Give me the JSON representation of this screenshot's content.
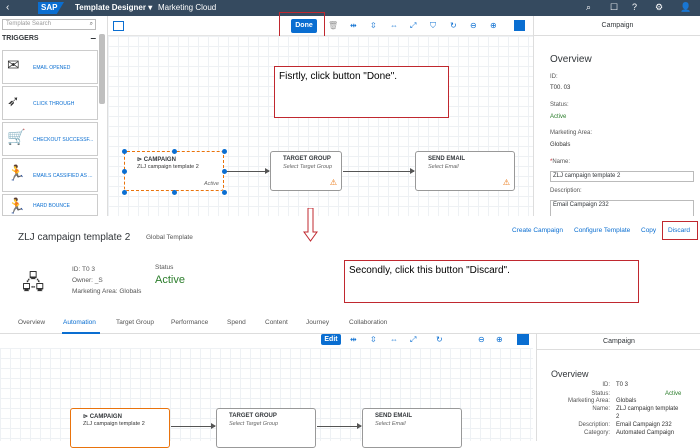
{
  "shell": {
    "logo": "SAP",
    "app_title": "Template Designer",
    "app_title_caret": "▾",
    "product": "Marketing Cloud",
    "icons": [
      "search-icon",
      "notification-icon",
      "help-icon",
      "settings-icon",
      "user-icon"
    ]
  },
  "left_panel": {
    "search_placeholder": "Template Search",
    "section": "TRIGGERS",
    "collapse": "–",
    "items": [
      {
        "label": "EMAIL OPENED",
        "icon": "✉"
      },
      {
        "label": "CLICK THROUGH",
        "icon": "➶"
      },
      {
        "label": "CHECKOUT SUCCESSF...",
        "icon": "🛒"
      },
      {
        "label": "EMAILS CASSIFIED AS ...",
        "icon": "🏃"
      },
      {
        "label": "HARD BOUNCE",
        "icon": "🏃"
      }
    ]
  },
  "toolbar": {
    "done_label": "Done"
  },
  "note1": "Fisrtly, click button \"Done\".",
  "note2": "Secondly, click this button \"Discard\".",
  "nodes": {
    "campaign": {
      "title": "CAMPAIGN",
      "subtitle": "ZLJ campaign template 2",
      "status": "Active"
    },
    "target": {
      "title": "TARGET GROUP",
      "subtitle": "Select Target Group"
    },
    "email": {
      "title": "SEND EMAIL",
      "subtitle": "Select Email"
    }
  },
  "right_panel": {
    "header": "Campaign",
    "overview": "Overview",
    "id_label": "ID:",
    "id_value": "T00.          03",
    "status_label": "Status:",
    "status_value": "Active",
    "area_label": "Marketing Area:",
    "area_value": "Globals",
    "name_label": "Name:",
    "name_required": "*",
    "name_value": "ZLJ campaign template 2",
    "desc_label": "Description:",
    "desc_value": "Email Campaign 232"
  },
  "section2": {
    "title": "ZLJ campaign template 2",
    "subtitle": "Global Template",
    "links": {
      "create": "Create Campaign",
      "configure": "Configure Template",
      "copy": "Copy",
      "discard": "Discard"
    },
    "id_line": "ID: T0           3",
    "owner_line": "Owner: _S",
    "area_line": "Marketing Area: Globals",
    "status_label": "Status",
    "status_value": "Active",
    "tabs": [
      "Overview",
      "Automation",
      "Target Group",
      "Performance",
      "Spend",
      "Content",
      "Journey",
      "Collaboration"
    ],
    "edit_label": "Edit",
    "panel": {
      "header": "Campaign",
      "overview": "Overview",
      "rows": [
        {
          "k": "ID:",
          "v": "T0            3"
        },
        {
          "k": "Status:",
          "v": "",
          "extra": "Active"
        },
        {
          "k": "Marketing Area:",
          "v": "Globals"
        },
        {
          "k": "Name:",
          "v": "ZLJ campaign template"
        },
        {
          "k": "",
          "v": "2"
        },
        {
          "k": "Description:",
          "v": "Email Campaign 232"
        },
        {
          "k": "Category:",
          "v": "Automated Campaign"
        }
      ]
    }
  }
}
